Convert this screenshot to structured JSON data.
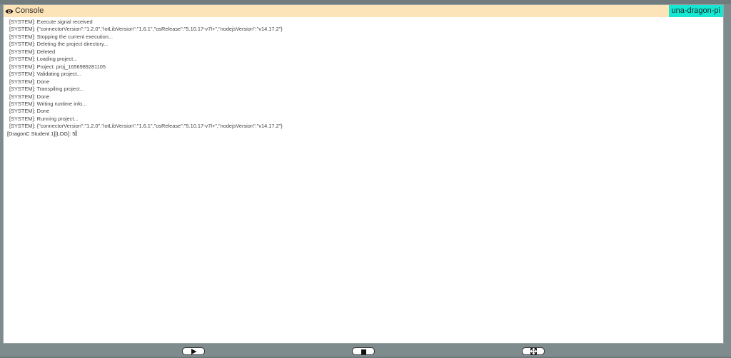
{
  "console": {
    "title": "Console",
    "device": "una-dragon-pi",
    "icon": "eye-icon",
    "logs": [
      "[SYSTEM]: Execute signal received",
      "[SYSTEM]: {\"connectorVersion\":\"1.2.0\",\"iotLibVersion\":\"1.6.1\",\"osRelease\":\"5.10.17-v7l+\",\"nodejsVersion\":\"v14.17.2\"}",
      "[SYSTEM]: Stopping the current execution...",
      "[SYSTEM]: Deleting the project directory...",
      "[SYSTEM]: Deleted",
      "[SYSTEM]: Loading project...",
      "[SYSTEM]: Project: proj_1656989281105",
      "[SYSTEM]: Validating project...",
      "[SYSTEM]: Done",
      "[SYSTEM]: Transpiling project...",
      "[SYSTEM]: Done",
      "[SYSTEM]: Writing runtime info...",
      "[SYSTEM]: Done",
      "[SYSTEM]: Running project...",
      "[SYSTEM]: {\"connectorVersion\":\"1.2.0\",\"iotLibVersion\":\"1.6.1\",\"osRelease\":\"5.10.17-v7l+\",\"nodejsVersion\":\"v14.17.2\"}"
    ],
    "user_log": "[DragonC Student 1][LOG]: 5"
  },
  "controls": {
    "play_icon": "play-icon",
    "stop_icon": "stop-icon",
    "fullscreen_icon": "fullscreen-icon"
  },
  "colors": {
    "header_bg": "#fde3b8",
    "device_badge_bg": "#16e7d3",
    "backdrop": "#7f8c8d"
  }
}
